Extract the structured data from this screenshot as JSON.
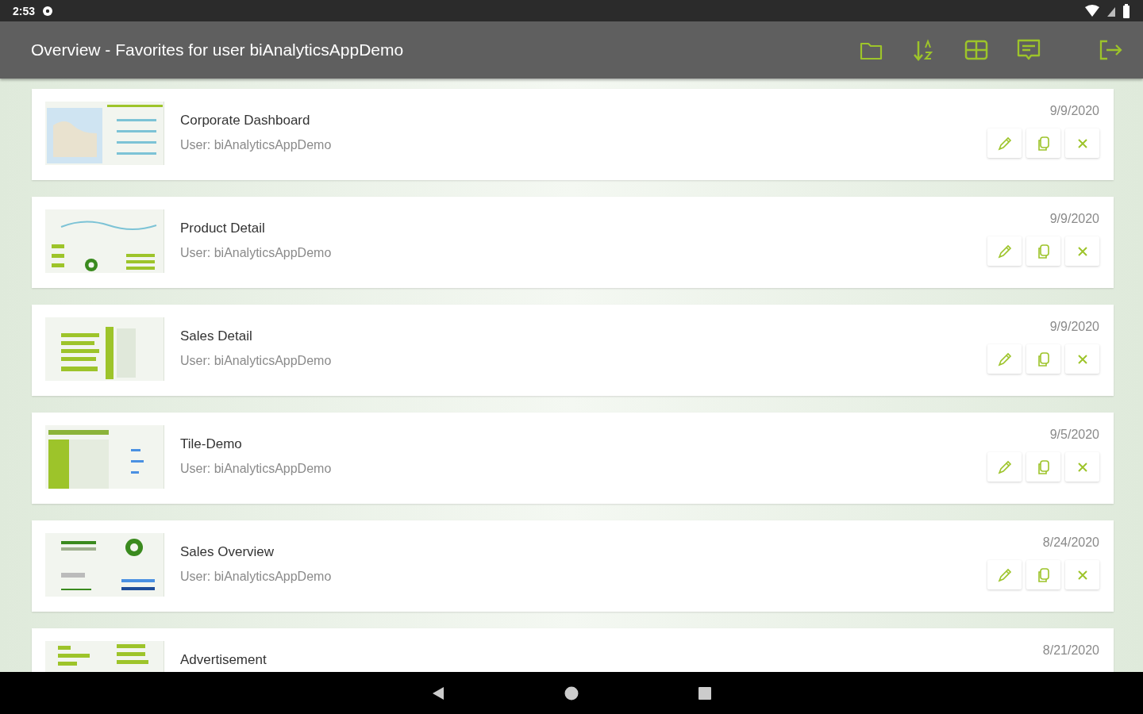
{
  "status_bar": {
    "time": "2:53"
  },
  "app_bar": {
    "title": "Overview - Favorites for user biAnalyticsAppDemo"
  },
  "favorites": [
    {
      "title": "Corporate Dashboard",
      "user": "User: biAnalyticsAppDemo",
      "date": "9/9/2020"
    },
    {
      "title": "Product Detail",
      "user": "User: biAnalyticsAppDemo",
      "date": "9/9/2020"
    },
    {
      "title": "Sales Detail",
      "user": "User: biAnalyticsAppDemo",
      "date": "9/9/2020"
    },
    {
      "title": "Tile-Demo",
      "user": "User: biAnalyticsAppDemo",
      "date": "9/5/2020"
    },
    {
      "title": "Sales Overview",
      "user": "User: biAnalyticsAppDemo",
      "date": "8/24/2020"
    },
    {
      "title": "Advertisement",
      "date": "8/21/2020"
    }
  ]
}
